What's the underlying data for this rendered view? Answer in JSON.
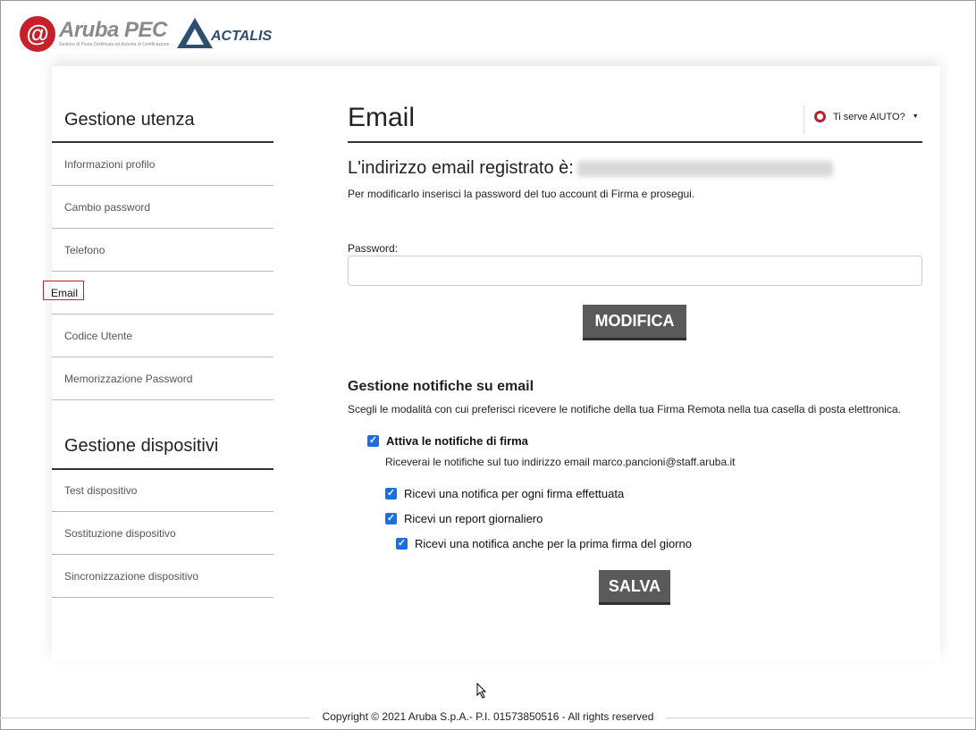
{
  "header": {
    "aruba_brand": "Aruba PEC",
    "aruba_tagline": "Gestore di Posta Certificata ed Autorita di Certificazione",
    "actalis_brand": "ACTALIS"
  },
  "sidebar": {
    "section1_title": "Gestione utenza",
    "section1_items": [
      "Informazioni profilo",
      "Cambio password",
      "Telefono",
      "Email",
      "Codice Utente",
      "Memorizzazione Password"
    ],
    "section2_title": "Gestione dispositivi",
    "section2_items": [
      "Test dispositivo",
      "Sostituzione dispositivo",
      "Sincronizzazione dispositivo"
    ]
  },
  "main": {
    "title": "Email",
    "help_label": "Ti serve AIUTO?",
    "registered_label": "L'indirizzo email registrato è:",
    "registered_sub": "Per modificarlo inserisci la password del tuo account di Firma e prosegui.",
    "password_label": "Password:",
    "password_value": "",
    "modifica_label": "MODIFICA",
    "notif_title": "Gestione notifiche su email",
    "notif_sub": "Scegli le modalità con cui preferisci ricevere le notifiche della tua Firma Remota nella tua casella di posta elettronica.",
    "notif_main": "Attiva le notifiche di firma",
    "notif_note": "Riceverai le notifiche sul tuo indirizzo email marco.pancioni@staff.aruba.it",
    "opt1": "Ricevi una notifica per ogni firma effettuata",
    "opt2": "Ricevi un report giornaliero",
    "opt3": "Ricevi una notifica anche per la prima firma del giorno",
    "salva_label": "SALVA"
  },
  "footer": {
    "copyright": "Copyright © 2021 Aruba S.p.A.- P.I. 01573850516 - All rights reserved"
  },
  "colors": {
    "brand_red": "#c8202a",
    "actalis_blue": "#2d4e73",
    "button_gray": "#5a5a5a",
    "checkbox_blue": "#1a6fe0"
  }
}
